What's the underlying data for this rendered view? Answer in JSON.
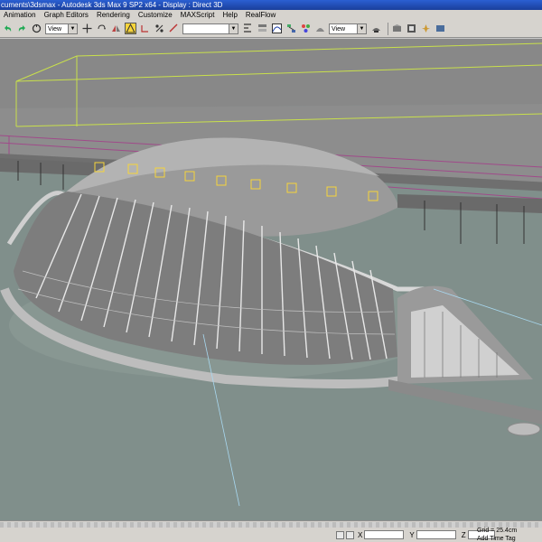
{
  "window": {
    "title": "cuments\\3dsmax   - Autodesk 3ds Max 9 SP2 x64   - Display : Direct 3D"
  },
  "menu": {
    "items": [
      {
        "label": "Animation"
      },
      {
        "label": "Graph Editors"
      },
      {
        "label": "Rendering"
      },
      {
        "label": "Customize"
      },
      {
        "label": "MAXScript"
      },
      {
        "label": "Help"
      },
      {
        "label": "RealFlow"
      }
    ]
  },
  "toolbar": {
    "ref_coord_dropdown": "View",
    "named_selection_dropdown": "",
    "render_view_dropdown": "View",
    "icons": [
      "undo-icon",
      "redo-icon",
      "select-link-icon",
      "unlink-icon",
      "bind-icon",
      "select-move-icon",
      "select-rotate-icon",
      "select-scale-icon",
      "pivot-icon",
      "snap-icon",
      "angle-snap-icon",
      "percent-snap-icon",
      "spinner-snap-icon",
      "mirror-icon",
      "align-icon",
      "layer-icon",
      "curve-editor-icon",
      "schematic-icon",
      "material-editor-icon",
      "render-setup-icon",
      "quick-render-icon",
      "teapot-icon"
    ]
  },
  "status": {
    "x_label": "X",
    "y_label": "Y",
    "z_label": "Z",
    "grid_text": "Grid = 25.4cm",
    "add_time_tag": "Add Time Tag"
  },
  "colors": {
    "titlebar": "#1f4bb5",
    "viewport_bg": "#7e8d89",
    "wireframe_yellow": "#c9e04b",
    "wireframe_magenta": "#a04a8a",
    "selection_yellow": "#f7d43a"
  }
}
